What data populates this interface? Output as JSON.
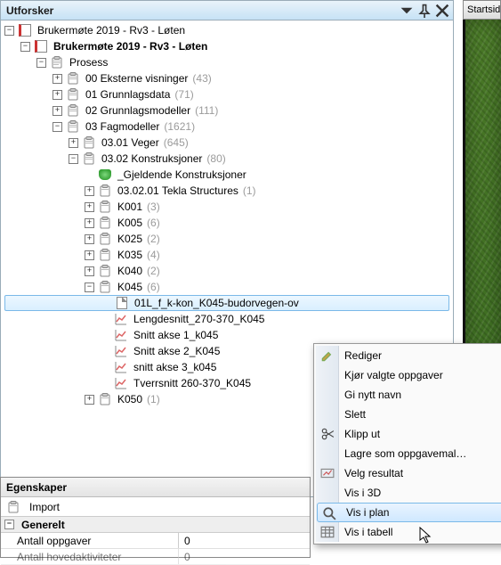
{
  "panel": {
    "title": "Utforsker"
  },
  "tree": {
    "root": {
      "label": "Brukermøte 2019 - Rv3 - Løten"
    },
    "root_bold": {
      "label": "Brukermøte 2019 - Rv3 - Løten"
    },
    "prosess": {
      "label": "Prosess"
    },
    "n00": {
      "label": "00 Eksterne visninger",
      "count": "(43)"
    },
    "n01": {
      "label": "01 Grunnlagsdata",
      "count": "(71)"
    },
    "n02": {
      "label": "02 Grunnlagsmodeller",
      "count": "(111)"
    },
    "n03": {
      "label": "03 Fagmodeller",
      "count": "(1621)"
    },
    "n0301": {
      "label": "03.01 Veger",
      "count": "(645)"
    },
    "n0302": {
      "label": "03.02 Konstruksjoner",
      "count": "(80)"
    },
    "gjeldende": {
      "label": "_Gjeldende Konstruksjoner"
    },
    "tekla": {
      "label": "03.02.01 Tekla Structures",
      "count": "(1)"
    },
    "k001": {
      "label": "K001",
      "count": "(3)"
    },
    "k005": {
      "label": "K005",
      "count": "(6)"
    },
    "k025": {
      "label": "K025",
      "count": "(2)"
    },
    "k035": {
      "label": "K035",
      "count": "(4)"
    },
    "k040": {
      "label": "K040",
      "count": "(2)"
    },
    "k045": {
      "label": "K045",
      "count": "(6)"
    },
    "sel_file": {
      "label": "01L_f_k-kon_K045-budorvegen-ov"
    },
    "lengdesnitt": {
      "label": "Lengdesnitt_270-370_K045"
    },
    "sn1": {
      "label": "Snitt akse 1_k045"
    },
    "sn2": {
      "label": "Snitt akse 2_K045"
    },
    "sn3": {
      "label": "snitt akse 3_k045"
    },
    "tverr": {
      "label": "Tverrsnitt 260-370_K045"
    },
    "k050": {
      "label": "K050",
      "count": "(1)"
    }
  },
  "props": {
    "title": "Egenskaper",
    "import_label": "Import",
    "section": "Generelt",
    "rows": {
      "antall_oppgaver": {
        "label": "Antall oppgaver",
        "value": "0"
      },
      "antall_hoved": {
        "label": "Antall hovedaktiviteter",
        "value": "0"
      }
    }
  },
  "right_tab": {
    "label": "Startsid"
  },
  "context_menu": {
    "rediger": "Rediger",
    "kjor": "Kjør valgte oppgaver",
    "ginavn": "Gi nytt navn",
    "slett": "Slett",
    "klipp": "Klipp ut",
    "lagre": "Lagre som oppgavemal…",
    "velg": "Velg resultat",
    "vis3d": "Vis i 3D",
    "visplan": "Vis i plan",
    "vistabell": "Vis i tabell"
  }
}
